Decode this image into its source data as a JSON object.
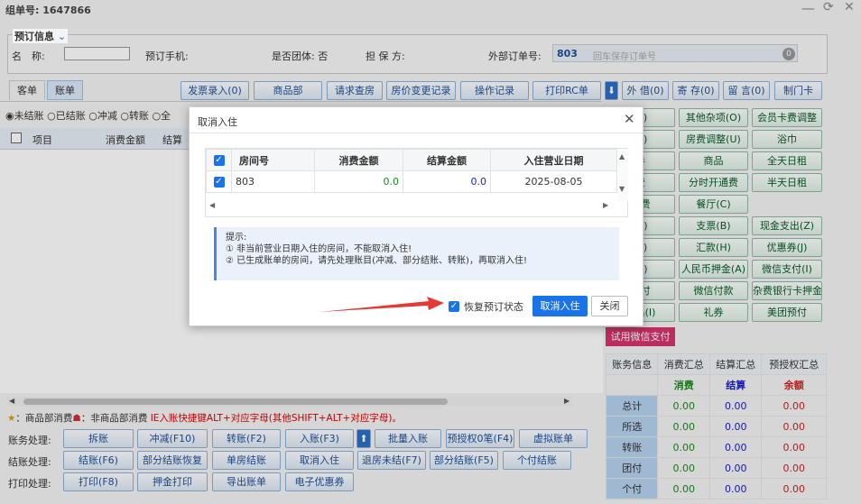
{
  "header": {
    "order_label": "组单号: 1647866"
  },
  "booking": {
    "section_title": "预订信息",
    "name_label": "名　称:",
    "phone_label": "预订手机:",
    "group_label": "是否团体: 否",
    "guarantor_label": "担 保 方:",
    "ext_order_label": "外部订单号:",
    "room_no": "803",
    "ext_order_placeholder": "回车保存订单号",
    "count_badge": "0"
  },
  "tabs": [
    "客单",
    "账单"
  ],
  "toolbar": [
    "发票录入(0)",
    "商品部",
    "请求查房",
    "房价变更记录",
    "操作记录",
    "打印RC单"
  ],
  "toolbar_right": [
    "外 借(0)",
    "寄 存(0)",
    "留 言(0)",
    "制门卡"
  ],
  "filters": [
    "未结账",
    "已结账",
    "冲减",
    "转账",
    "全"
  ],
  "list_headers": [
    "项目",
    "消费金额",
    "结算"
  ],
  "right_buttons": [
    [
      "(P)",
      "其他杂项(O)",
      "会员卡费调整"
    ],
    [
      "(E)",
      "房费调整(U)",
      "浴巾"
    ],
    [
      "券",
      "商品",
      "全天日租"
    ],
    [
      "费",
      "分时开通费",
      "半天日租"
    ],
    [
      "房费",
      "餐厅(C)",
      ""
    ],
    [
      "(X)",
      "支票(B)",
      "现金支出(Z)"
    ],
    [
      "(Y)",
      "汇款(H)",
      "优惠券(J)"
    ],
    [
      "(R)",
      "人民币押金(A)",
      "微信支付(I)"
    ],
    [
      "预付",
      "微信付款",
      "杂费银行卡押金"
    ],
    [
      "支出(I)",
      "礼券",
      "美团预付"
    ]
  ],
  "wechat_btn": "试用微信支付",
  "summary": {
    "headers": [
      "账务信息",
      "消费汇总",
      "结算汇总",
      "预授权汇总"
    ],
    "sub": [
      "消费",
      "结算",
      "余额"
    ],
    "rows": [
      [
        "总计",
        "0.00",
        "0.00",
        "0.00"
      ],
      [
        "所选",
        "0.00",
        "0.00",
        "0.00"
      ],
      [
        "转账",
        "0.00",
        "0.00",
        "0.00"
      ],
      [
        "团付",
        "0.00",
        "0.00",
        "0.00"
      ],
      [
        "个付",
        "0.00",
        "0.00",
        "0.00"
      ]
    ]
  },
  "hint_bar": {
    "a": "：商品部消费",
    "b": "：非商品部消费",
    "c": "IE入账快捷键ALT+对应字母(其他SHIFT+ALT+对应字母)。"
  },
  "action_rows": [
    {
      "label": "账务处理:",
      "buttons": [
        "拆账",
        "冲减(F10)",
        "转账(F2)",
        "入账(F3)",
        "批量入账",
        "预授权0笔(F4)",
        "虚拟账单"
      ]
    },
    {
      "label": "结账处理:",
      "buttons": [
        "结账(F6)",
        "部分结账恢复",
        "单房结账",
        "取消入住",
        "退房未结(F7)",
        "部分结账(F5)",
        "个付结账"
      ]
    },
    {
      "label": "打印处理:",
      "buttons": [
        "打印(F8)",
        "押金打印",
        "导出账单",
        "电子优惠券"
      ]
    }
  ],
  "dialog": {
    "title": "取消入住",
    "headers": [
      "房间号",
      "消费金额",
      "结算金额",
      "入住营业日期"
    ],
    "row": {
      "room": "803",
      "consume": "0.0",
      "settle": "0.0",
      "date": "2025-08-05"
    },
    "tip_title": "提示:",
    "tip1": "① 非当前营业日期入住的房间，不能取消入住!",
    "tip2": "② 已生成账单的房间，请先处理账目(冲减、部分结账、转账)，再取消入住!",
    "restore_label": "恢复预订状态",
    "confirm": "取消入住",
    "close": "关闭"
  },
  "colors": {
    "accent": "#1a73e8",
    "green": "#1a8a1a",
    "blue": "#1a1acc",
    "red": "#cc2222",
    "arrow": "#e53935"
  }
}
